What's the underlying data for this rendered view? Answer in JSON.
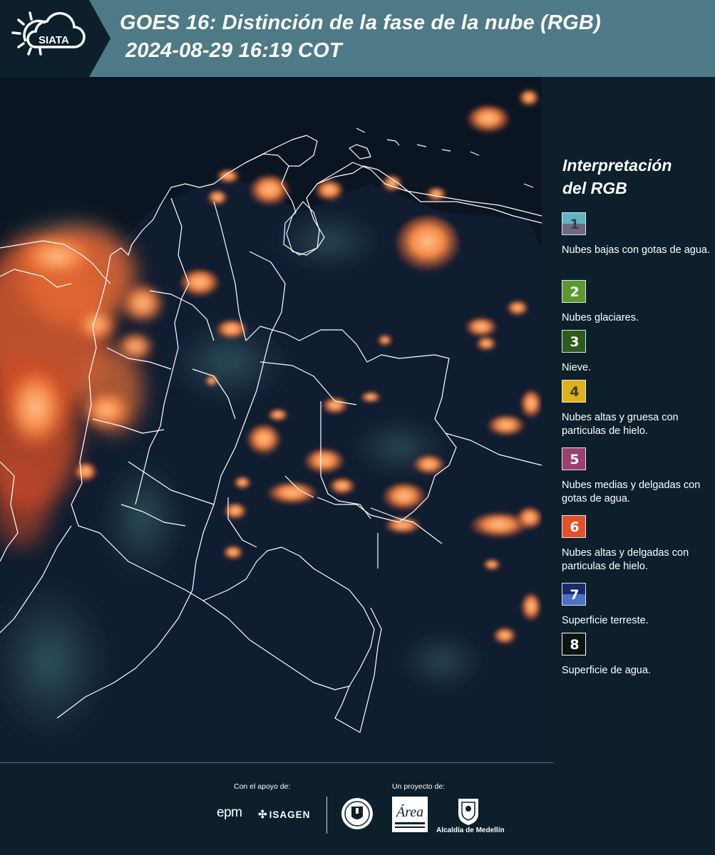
{
  "header": {
    "logo_text": "SIATA",
    "title_line1": "GOES 16: Distinción de la fase de la nube (RGB)",
    "title_line2": "2024-08-29 16:19 COT"
  },
  "legend": {
    "title_line1": "Interpretación",
    "title_line2": "del RGB",
    "items": [
      {
        "number": "1",
        "text": "Nubes bajas con gotas de agua.",
        "color_top": "#5fb4c6",
        "color_bottom": "#6e6880",
        "number_color": "#3b3b4a"
      },
      {
        "number": "2",
        "text": "Nubes glaciares.",
        "color_top": "#5a9a2c",
        "color_bottom": "#5a9a2c",
        "number_color": "#ffffff"
      },
      {
        "number": "3",
        "text": "Nieve.",
        "color_top": "#2e5a1e",
        "color_bottom": "#2e5a1e",
        "number_color": "#ffffff"
      },
      {
        "number": "4",
        "text": "Nubes altas y gruesa con particulas de hielo.",
        "color_top": "#e0b21a",
        "color_bottom": "#e0b21a",
        "number_color": "#3b3b3b"
      },
      {
        "number": "5",
        "text": "Nubes medias y delgadas con gotas de agua.",
        "color_top": "#9b3f6e",
        "color_bottom": "#9b3f6e",
        "number_color": "#ffffff"
      },
      {
        "number": "6",
        "text": "Nubes altas y delgadas con particulas de hielo.",
        "color_top": "#e2512a",
        "color_bottom": "#e2512a",
        "number_color": "#ffffff"
      },
      {
        "number": "7",
        "text": "Superficie terreste.",
        "color_top": "#172a6a",
        "color_bottom": "#4a72c6",
        "number_color": "#ffffff"
      },
      {
        "number": "8",
        "text": "Superficie de agua.",
        "color_top": "#0c1410",
        "color_bottom": "#0c1410",
        "number_color": "#ffffff"
      }
    ]
  },
  "footer": {
    "support_label": "Con el apoyo de:",
    "project_label": "Un proyecto de:",
    "epm": "epm",
    "isagen": "ISAGEN",
    "area_metropolitana": "Área",
    "alcaldia": "Alcaldía de Medellín"
  },
  "colors": {
    "header_bg": "#4e7a87",
    "logo_bg": "#0c1f2b",
    "page_bg": "#0c1f2b",
    "cloud_orange": "#f07a3c",
    "border_white": "#ffffff"
  }
}
